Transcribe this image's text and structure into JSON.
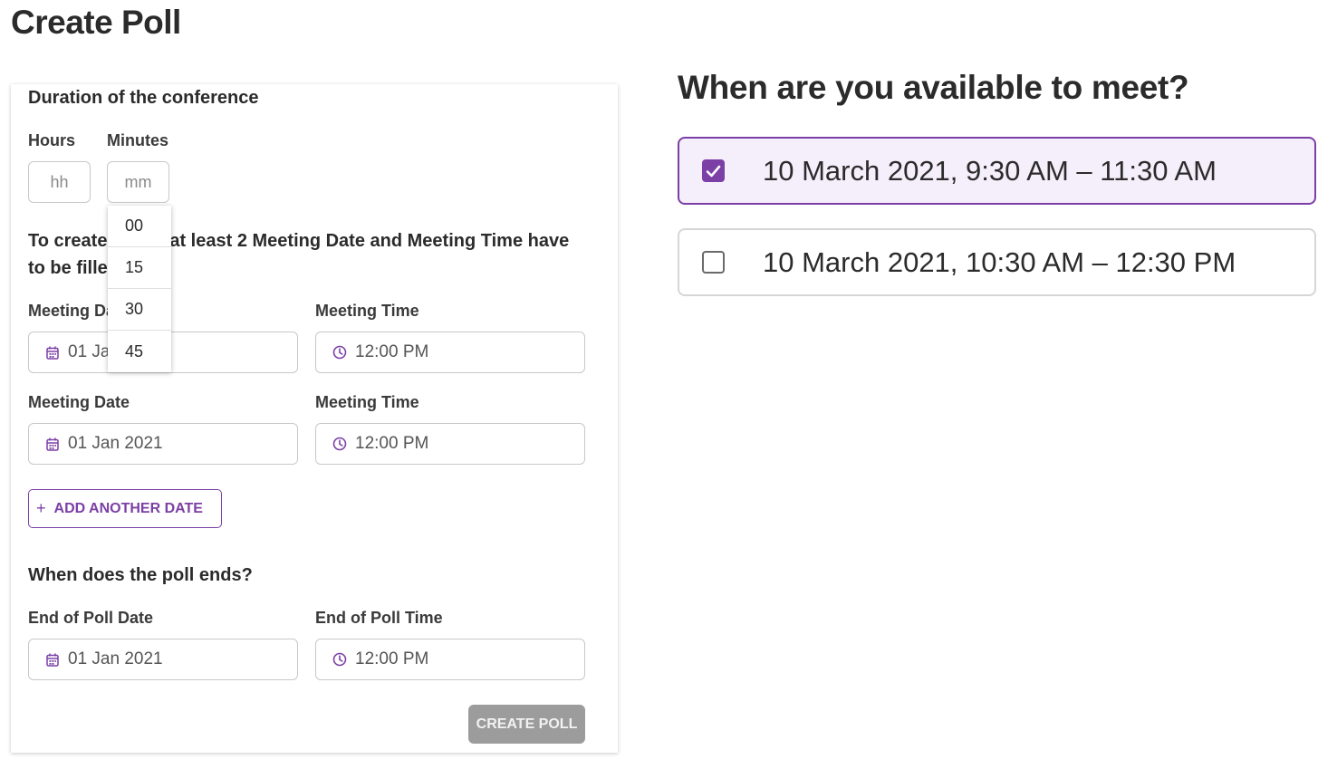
{
  "page_title": "Create Poll",
  "form": {
    "duration_title": "Duration of the conference",
    "hours_label": "Hours",
    "hours_placeholder": "hh",
    "minutes_label": "Minutes",
    "minutes_placeholder": "mm",
    "minutes_options": [
      "00",
      "15",
      "30",
      "45"
    ],
    "notice_before": "To create a poll, at least 2 Meeting Date and Meeting Time have to be filled in.",
    "meeting_rows": [
      {
        "date_label": "Meeting Date",
        "date_value": "01 Jan 2021",
        "time_label": "Meeting Time",
        "time_value": "12:00 PM"
      },
      {
        "date_label": "Meeting Date",
        "date_value": "01 Jan 2021",
        "time_label": "Meeting Time",
        "time_value": "12:00 PM"
      }
    ],
    "add_date_label": "ADD ANOTHER DATE",
    "poll_end_title": "When does the poll ends?",
    "end_date_label": "End of Poll Date",
    "end_date_value": "01 Jan 2021",
    "end_time_label": "End of Poll Time",
    "end_time_value": "12:00 PM",
    "create_label": "CREATE POLL"
  },
  "preview": {
    "title": "When are you available to meet?",
    "options": [
      {
        "text": "10 March 2021, 9:30 AM – 11:30 AM",
        "checked": true
      },
      {
        "text": "10 March 2021, 10:30 AM – 12:30 PM",
        "checked": false
      }
    ]
  },
  "colors": {
    "accent": "#7b3fa6",
    "disabled_button": "#9c9c9c",
    "selected_bg": "#f5eefb"
  }
}
